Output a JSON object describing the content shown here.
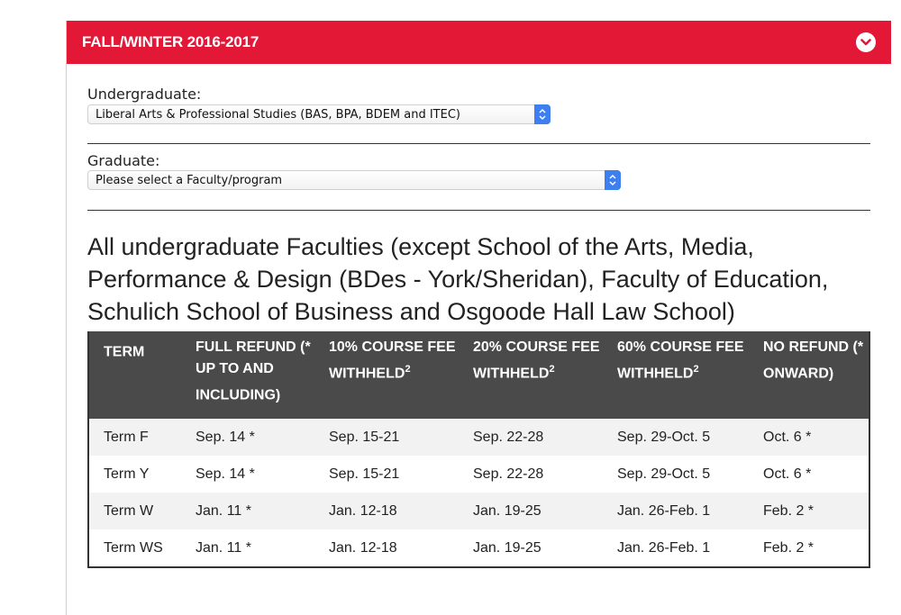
{
  "accordion": {
    "title": "FALL/WINTER 2016-2017",
    "toggle_icon": "chevron-down-icon",
    "accent_color": "#e31837"
  },
  "undergraduate": {
    "label": "Undergraduate:",
    "selected": "Liberal Arts & Professional Studies (BAS, BPA, BDEM and ITEC)"
  },
  "graduate": {
    "label": "Graduate:",
    "selected": "Please select a Faculty/program"
  },
  "heading": "All undergraduate Faculties (except School of the Arts, Media, Performance & Design (BDes - York/Sheridan), Faculty of Education, Schulich School of Business and Osgoode Hall Law School)",
  "table": {
    "headers": [
      {
        "text": "TERM",
        "sup": ""
      },
      {
        "text": "FULL REFUND (* UP TO AND INCLUDING)",
        "sup": ""
      },
      {
        "text": "10% COURSE FEE WITHHELD",
        "sup": "2"
      },
      {
        "text": "20% COURSE FEE WITHHELD",
        "sup": "2"
      },
      {
        "text": "60% COURSE FEE WITHHELD",
        "sup": "2"
      },
      {
        "text": "NO REFUND (* ONWARD)",
        "sup": ""
      }
    ],
    "rows": [
      [
        "Term F",
        "Sep. 14 *",
        "Sep. 15-21",
        "Sep. 22-28",
        "Sep. 29-Oct. 5",
        "Oct. 6 *"
      ],
      [
        "Term Y",
        "Sep. 14 *",
        "Sep. 15-21",
        "Sep. 22-28",
        "Sep. 29-Oct. 5",
        "Oct. 6 *"
      ],
      [
        "Term W",
        "Jan. 11 *",
        "Jan. 12-18",
        "Jan. 19-25",
        "Jan. 26-Feb. 1",
        "Feb. 2 *"
      ],
      [
        "Term WS",
        "Jan. 11 *",
        "Jan. 12-18",
        "Jan. 19-25",
        "Jan. 26-Feb. 1",
        "Feb. 2 *"
      ]
    ]
  }
}
